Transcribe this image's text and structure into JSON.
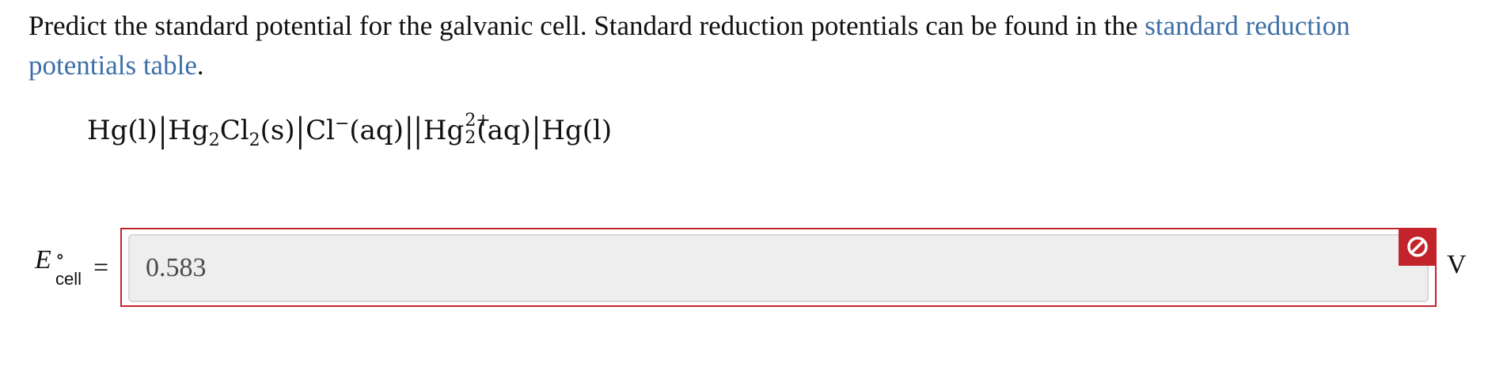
{
  "question": {
    "text_before": "Predict the standard potential for the galvanic cell. Standard reduction potentials can be found in the ",
    "link_label": "standard reduction potentials table",
    "text_after": "."
  },
  "cell_notation": {
    "part1": "Hg(l)",
    "bar1": "|",
    "part2_base": "Hg",
    "part2_sub": "2",
    "part3_base": "Cl",
    "part3_sub": "2",
    "part3_phase": "(s)",
    "bar2": "|",
    "part4_base": "Cl",
    "part4_sup": "−",
    "part4_phase": "(aq)",
    "bar3": "||",
    "part5_base": "Hg",
    "part5_sup": "2+",
    "part5_sub": "2",
    "part5_phase": "(aq)",
    "bar4": "|",
    "part6": "Hg(l)"
  },
  "answer": {
    "symbol": "E",
    "superscript": "∘",
    "subscript": "cell",
    "equals": "=",
    "value": "0.583",
    "unit": "V",
    "status": "incorrect",
    "status_icon": "prohibited-icon"
  },
  "colors": {
    "link": "#3d6fa8",
    "error": "#c3242b",
    "input_background": "#eeeeee"
  }
}
